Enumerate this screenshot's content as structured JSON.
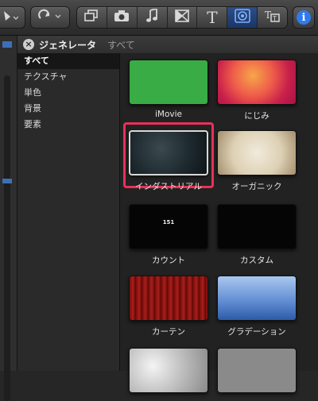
{
  "toolbar": {
    "tools": [
      "copy-layers-icon",
      "camera-icon",
      "music-note-icon",
      "transition-icon",
      "text-icon",
      "generator-icon",
      "themes-icon"
    ],
    "active_tool": "generator-icon",
    "info_label": "i"
  },
  "header": {
    "title": "ジェネレータ",
    "breadcrumb": "すべて"
  },
  "sidebar": {
    "items": [
      {
        "label": "すべて",
        "selected": true
      },
      {
        "label": "テクスチャ"
      },
      {
        "label": "単色"
      },
      {
        "label": "背景"
      },
      {
        "label": "要素"
      }
    ]
  },
  "grid": {
    "tiles": [
      {
        "label": "iMovie",
        "thumb": "green"
      },
      {
        "label": "にじみ",
        "thumb": "blur"
      },
      {
        "label": "インダストリアル",
        "thumb": "industrial",
        "selected": true
      },
      {
        "label": "オーガニック",
        "thumb": "organic"
      },
      {
        "label": "カウント",
        "thumb": "count",
        "thumb_text": "151"
      },
      {
        "label": "カスタム",
        "thumb": "black"
      },
      {
        "label": "カーテン",
        "thumb": "curtain"
      },
      {
        "label": "グラデーション",
        "thumb": "gradient"
      }
    ]
  },
  "colors": {
    "selection_border": "#e8315a",
    "active_tool_bg": "#2d4f86",
    "info_blue": "#2f7af0"
  }
}
